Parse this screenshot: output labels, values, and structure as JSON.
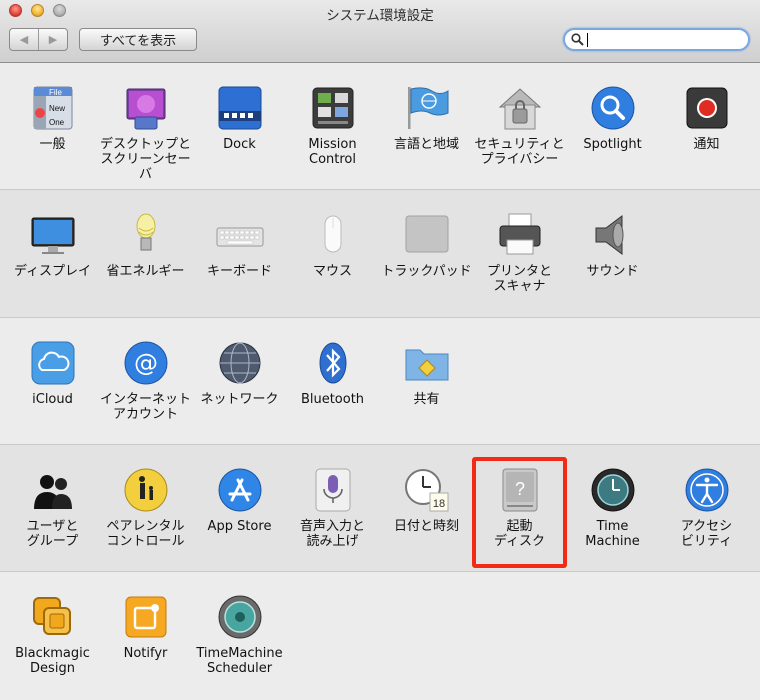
{
  "window": {
    "title": "システム環境設定",
    "show_all_label": "すべてを表示",
    "back_label": "◀",
    "forward_label": "▶",
    "search": {
      "value": "",
      "placeholder": ""
    }
  },
  "icons": {
    "general": "general-icon",
    "desktop": "desktop-screensaver-icon",
    "dock": "dock-icon",
    "mission": "mission-control-icon",
    "language": "language-region-icon",
    "security": "security-privacy-icon",
    "spotlight": "spotlight-icon",
    "notifications": "notifications-icon"
  },
  "rows": [
    {
      "panes": [
        {
          "id": "general",
          "label": "一般"
        },
        {
          "id": "desktop",
          "label": "デスクトップと\nスクリーンセーバ"
        },
        {
          "id": "dock",
          "label": "Dock"
        },
        {
          "id": "mission",
          "label": "Mission\nControl"
        },
        {
          "id": "language",
          "label": "言語と地域"
        },
        {
          "id": "security",
          "label": "セキュリティと\nプライバシー"
        },
        {
          "id": "spotlight",
          "label": "Spotlight"
        },
        {
          "id": "notifications",
          "label": "通知"
        }
      ]
    },
    {
      "panes": [
        {
          "id": "display",
          "label": "ディスプレイ"
        },
        {
          "id": "energy",
          "label": "省エネルギー"
        },
        {
          "id": "keyboard",
          "label": "キーボード"
        },
        {
          "id": "mouse",
          "label": "マウス"
        },
        {
          "id": "trackpad",
          "label": "トラックパッド"
        },
        {
          "id": "printers",
          "label": "プリンタと\nスキャナ"
        },
        {
          "id": "sound",
          "label": "サウンド"
        }
      ]
    },
    {
      "panes": [
        {
          "id": "icloud",
          "label": "iCloud"
        },
        {
          "id": "internet-accounts",
          "label": "インターネット\nアカウント"
        },
        {
          "id": "network",
          "label": "ネットワーク"
        },
        {
          "id": "bluetooth",
          "label": "Bluetooth"
        },
        {
          "id": "sharing",
          "label": "共有"
        }
      ]
    },
    {
      "panes": [
        {
          "id": "users",
          "label": "ユーザと\nグループ"
        },
        {
          "id": "parental",
          "label": "ペアレンタル\nコントロール"
        },
        {
          "id": "appstore",
          "label": "App Store"
        },
        {
          "id": "dictation",
          "label": "音声入力と\n読み上げ"
        },
        {
          "id": "datetime",
          "label": "日付と時刻"
        },
        {
          "id": "startup",
          "label": "起動\nディスク"
        },
        {
          "id": "timemachine",
          "label": "Time\nMachine"
        },
        {
          "id": "accessibility",
          "label": "アクセシ\nビリティ"
        }
      ]
    },
    {
      "panes": [
        {
          "id": "blackmagic",
          "label": "Blackmagic\nDesign"
        },
        {
          "id": "notifyr",
          "label": "Notifyr"
        },
        {
          "id": "tmscheduler",
          "label": "TimeMachine\nScheduler"
        }
      ]
    }
  ],
  "general_icon_text": [
    "File",
    "New",
    "One"
  ],
  "datetime_icon_day": "18",
  "accent": {
    "highlight": "#f22b16",
    "search_focus": "#7aa7e0"
  }
}
